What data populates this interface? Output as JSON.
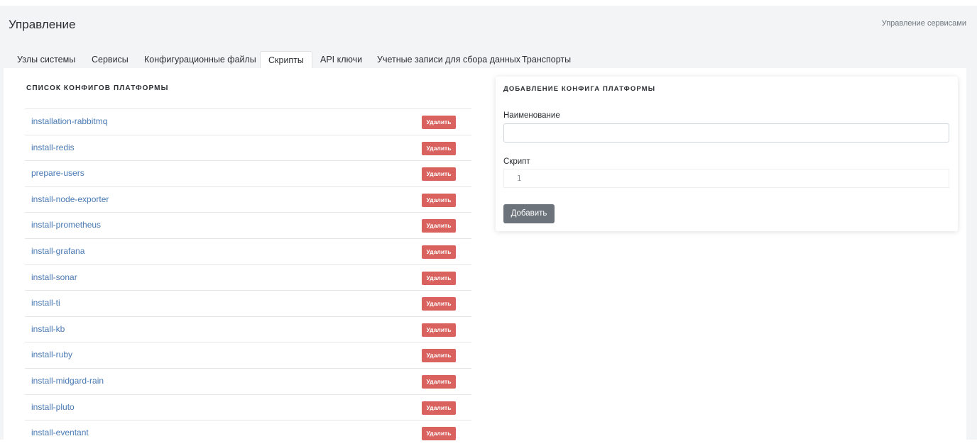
{
  "header": {
    "title": "Управление",
    "breadcrumb": "Управление сервисами"
  },
  "tabs": [
    {
      "label": "Узлы системы",
      "active": false
    },
    {
      "label": "Сервисы",
      "active": false
    },
    {
      "label": "Конфигурационные файлы",
      "active": false
    },
    {
      "label": "Скрипты",
      "active": true
    },
    {
      "label": "API ключи",
      "active": false
    },
    {
      "label": "Учетные записи для сбора данных",
      "active": false
    },
    {
      "label": "Транспорты",
      "active": false
    }
  ],
  "config_list": {
    "title": "СПИСОК КОНФИГОВ ПЛАТФОРМЫ",
    "delete_label": "Удалить",
    "items": [
      "installation-rabbitmq",
      "install-redis",
      "prepare-users",
      "install-node-exporter",
      "install-prometheus",
      "install-grafana",
      "install-sonar",
      "install-ti",
      "install-kb",
      "install-ruby",
      "install-midgard-rain",
      "install-pluto",
      "install-eventant"
    ]
  },
  "add_form": {
    "title": "ДОБАВЛЕНИЕ КОНФИГА ПЛАТФОРМЫ",
    "name_label": "Наименование",
    "name_value": "",
    "script_label": "Скрипт",
    "script_line_number": "1",
    "submit_label": "Добавить"
  },
  "colors": {
    "link": "#4a7ab4",
    "delete_button": "#d9625e",
    "submit_button": "#6c737b",
    "header_bg": "#f3f4f5"
  }
}
